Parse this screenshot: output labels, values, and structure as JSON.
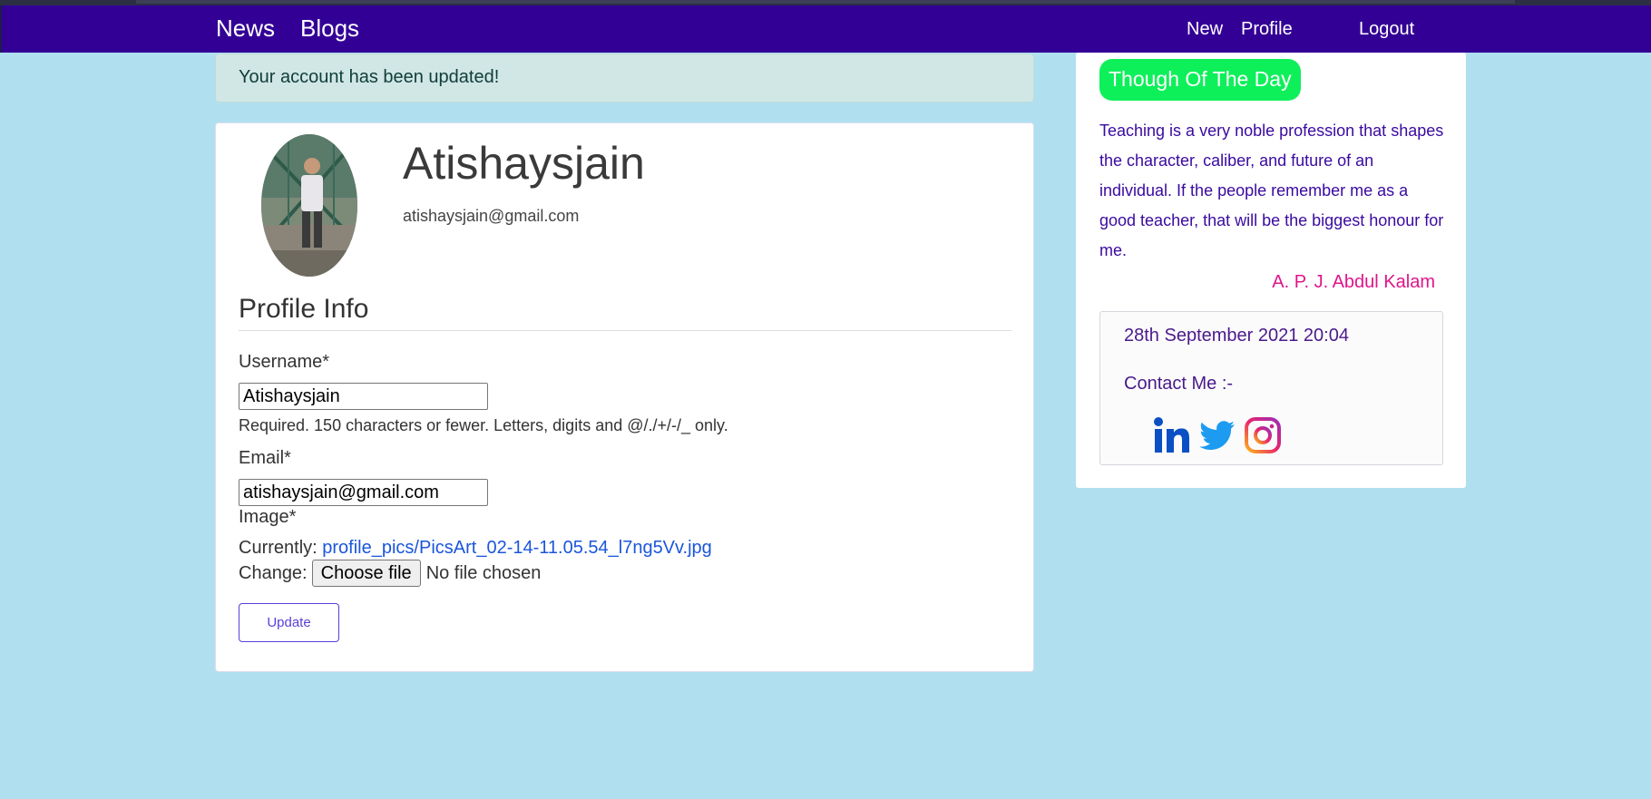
{
  "nav": {
    "brand_links": [
      {
        "label": "News"
      },
      {
        "label": "Blogs"
      }
    ],
    "right_links": [
      {
        "label": "New"
      },
      {
        "label": "Profile"
      },
      {
        "label": "Logout"
      }
    ]
  },
  "alert": {
    "message": "Your account has been updated!"
  },
  "profile": {
    "username": "Atishaysjain",
    "email": "atishaysjain@gmail.com",
    "avatar_icon": "profile-photo"
  },
  "form": {
    "section_title": "Profile Info",
    "username_label": "Username*",
    "username_value": "Atishaysjain",
    "username_help": "Required. 150 characters or fewer. Letters, digits and @/./+/-/_ only.",
    "email_label": "Email*",
    "email_value": "atishaysjain@gmail.com",
    "image_label": "Image*",
    "currently_label": "Currently:",
    "currently_link": "profile_pics/PicsArt_02-14-11.05.54_l7ng5Vv.jpg",
    "change_label": "Change:",
    "choose_file_label": "Choose file",
    "no_file_text": "No file chosen",
    "update_label": "Update"
  },
  "sidebar": {
    "badge": "Though Of The Day",
    "quote": "Teaching is a very noble profession that shapes the character, caliber, and future of an individual. If the people remember me as a good teacher, that will be the biggest honour for me.",
    "author": "A. P. J. Abdul Kalam",
    "datetime": "28th September 2021 20:04",
    "contact_label": "Contact Me :-",
    "social_icons": [
      "linkedin-icon",
      "twitter-icon",
      "instagram-icon"
    ]
  },
  "colors": {
    "navbar": "#330096",
    "page_bg": "#b0e0f0",
    "badge": "#0ef05a",
    "author": "#e0158c",
    "quote": "#3a0aa0",
    "link": "#1a56db"
  }
}
